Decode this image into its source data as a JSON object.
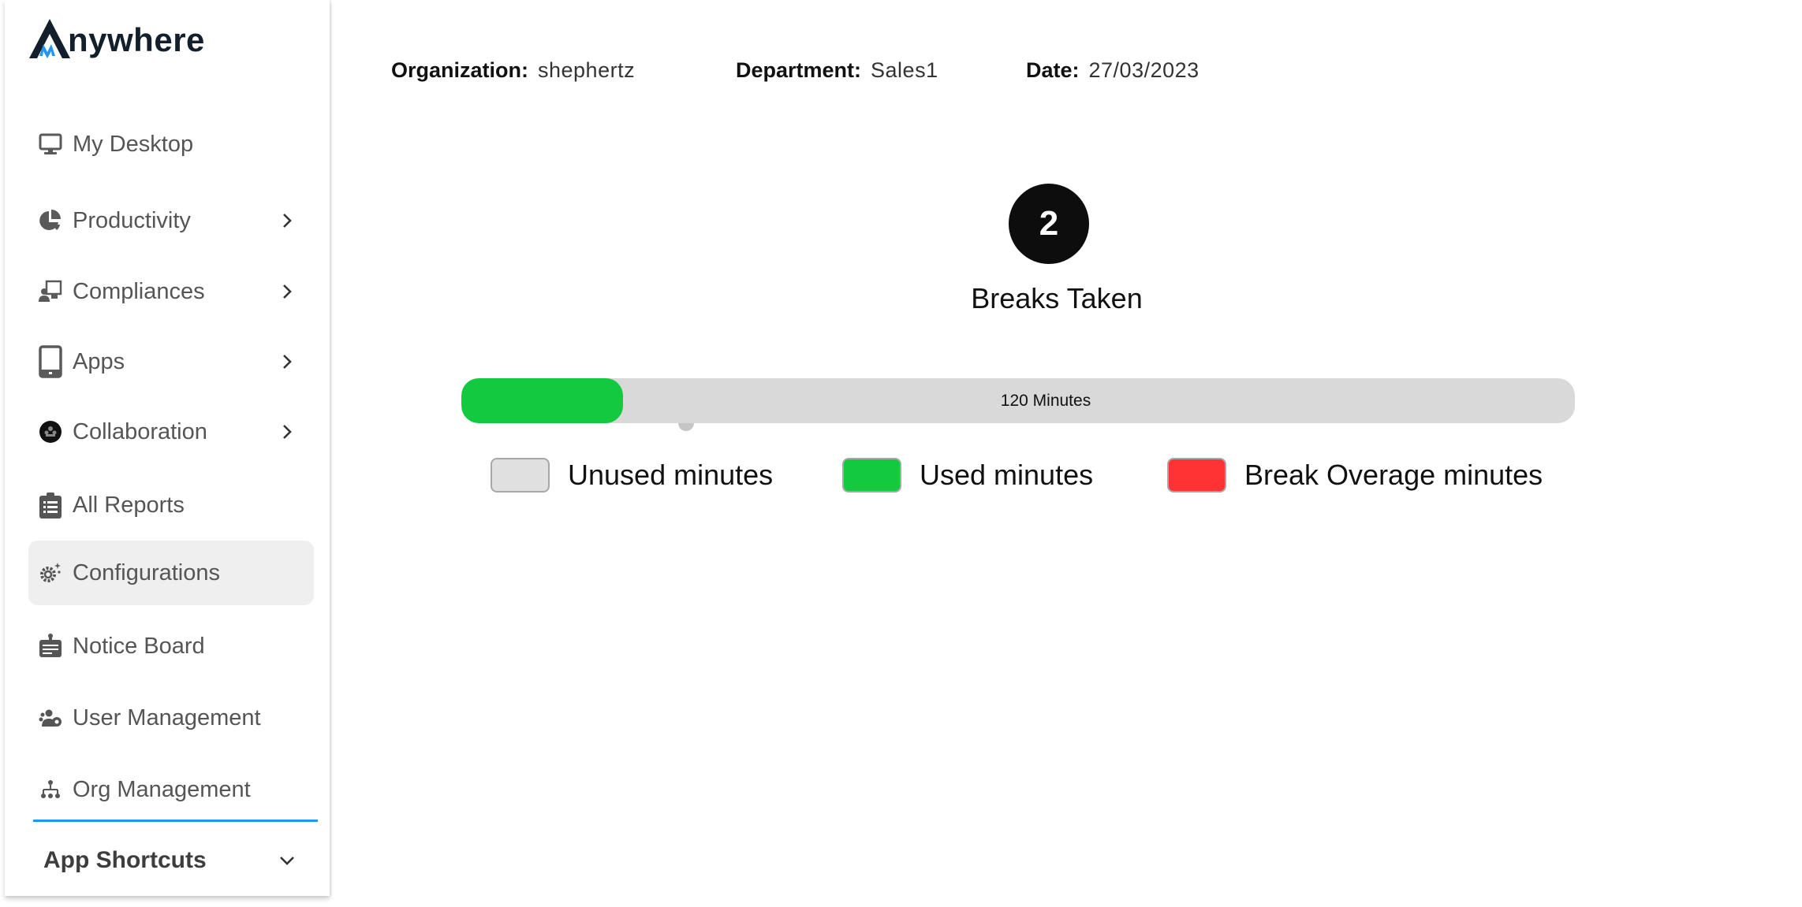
{
  "app": {
    "logo_text": "nywhere",
    "logo_initial": "A",
    "brand_colors": {
      "dark": "#13202b",
      "accent": "#2196f3"
    }
  },
  "sidebar": {
    "items": [
      {
        "label": "My Desktop",
        "icon": "monitor-icon",
        "has_submenu": false,
        "active": false
      },
      {
        "label": "Productivity",
        "icon": "pie-chart-icon",
        "has_submenu": true,
        "active": false
      },
      {
        "label": "Compliances",
        "icon": "presenter-icon",
        "has_submenu": true,
        "active": false
      },
      {
        "label": "Apps",
        "icon": "mobile-phone-icon",
        "has_submenu": true,
        "active": false
      },
      {
        "label": "Collaboration",
        "icon": "collaboration-icon",
        "has_submenu": true,
        "active": false
      },
      {
        "label": "All Reports",
        "icon": "clipboard-list-icon",
        "has_submenu": false,
        "active": false
      },
      {
        "label": "Configurations",
        "icon": "settings-gear-icon",
        "has_submenu": false,
        "active": true
      },
      {
        "label": "Notice Board",
        "icon": "notice-board-icon",
        "has_submenu": false,
        "active": false
      },
      {
        "label": "User Management",
        "icon": "users-gear-icon",
        "has_submenu": false,
        "active": false
      },
      {
        "label": "Org Management",
        "icon": "org-chart-icon",
        "has_submenu": false,
        "active": false
      }
    ],
    "shortcuts": {
      "label": "App Shortcuts",
      "icon": "chevron-down-icon",
      "expanded": false
    }
  },
  "header": {
    "organization": {
      "key": "Organization:",
      "value": "shephertz"
    },
    "department": {
      "key": "Department:",
      "value": "Sales1"
    },
    "date": {
      "key": "Date:",
      "value": "27/03/2023"
    }
  },
  "breaks": {
    "count": "2",
    "label": "Breaks Taken",
    "bar_label": "120 Minutes",
    "total_minutes": 120,
    "used_fraction": 0.145,
    "overage_fraction": 0,
    "colors": {
      "unused": "#d9d9d9",
      "used": "#13c940",
      "overage": "#ff3333"
    }
  },
  "legend": [
    {
      "label": "Unused minutes",
      "color": "#e0e0e0"
    },
    {
      "label": "Used minutes",
      "color": "#13c940"
    },
    {
      "label": "Break Overage minutes",
      "color": "#ff3333"
    }
  ]
}
